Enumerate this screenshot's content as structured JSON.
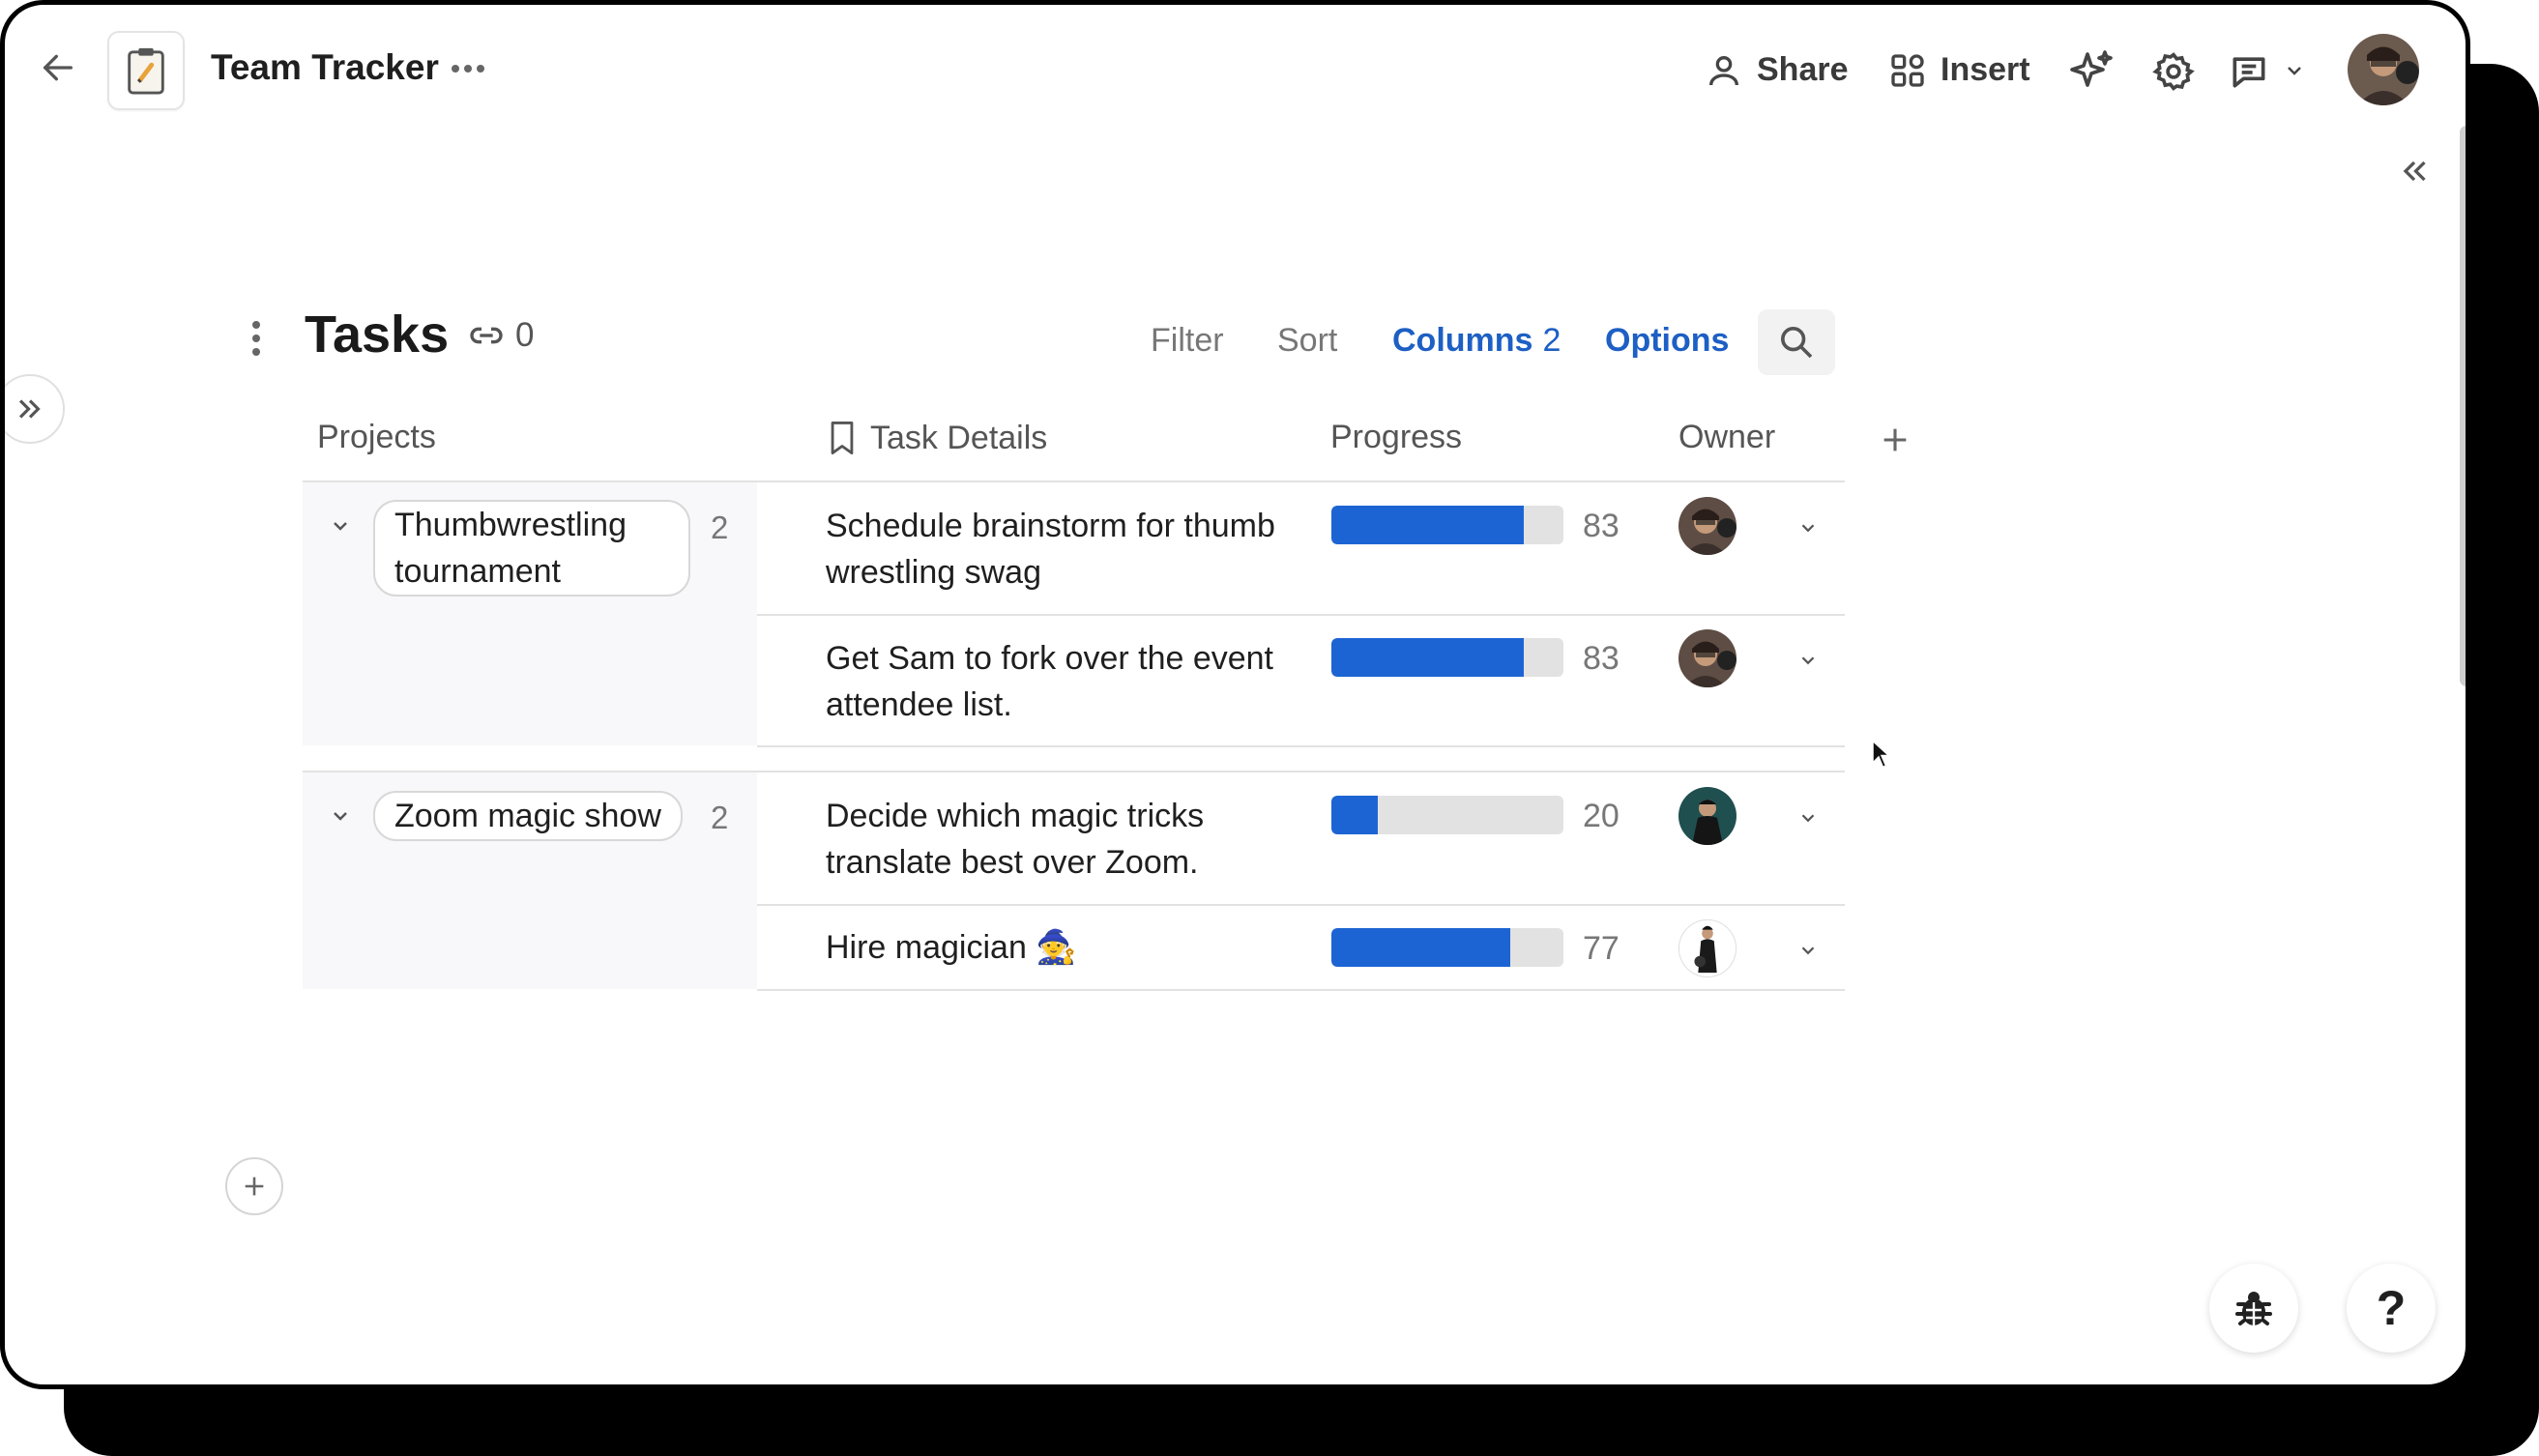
{
  "header": {
    "title": "Team Tracker",
    "share_label": "Share",
    "insert_label": "Insert"
  },
  "table": {
    "title": "Tasks",
    "link_count": "0",
    "controls": {
      "filter": "Filter",
      "sort": "Sort",
      "columns": "Columns",
      "columns_count": "2",
      "options": "Options"
    },
    "columns": [
      "Projects",
      "Task Details",
      "Progress",
      "Owner"
    ],
    "groups": [
      {
        "project_line1": "Thumbwrestling",
        "project_line2": "tournament",
        "count": "2",
        "rows": [
          {
            "line1": "Schedule brainstorm for thumb",
            "line2": "wrestling swag",
            "progress": 83,
            "progress_label": "83"
          },
          {
            "line1": "Get Sam to fork over the event",
            "line2": "attendee list.",
            "progress": 83,
            "progress_label": "83"
          }
        ]
      },
      {
        "project_line1": "Zoom magic show",
        "count": "2",
        "rows": [
          {
            "line1": "Decide which magic tricks",
            "line2": "translate best over Zoom.",
            "progress": 20,
            "progress_label": "20"
          },
          {
            "line1": "Hire magician 🧙",
            "line2": "",
            "progress": 77,
            "progress_label": "77"
          }
        ]
      }
    ]
  },
  "colors": {
    "accent": "#1d5fc4",
    "progress_fill": "#1c64d3",
    "progress_track": "#e2e2e2"
  },
  "icons": {
    "back": "arrow-left-icon",
    "doc": "clipboard-icon",
    "share": "person-icon",
    "insert": "grid-icon",
    "ai": "sparkle-icon",
    "settings": "gear-icon",
    "comments": "comment-icon",
    "bug": "bug-icon",
    "help": "question-icon"
  },
  "help_label": "?"
}
